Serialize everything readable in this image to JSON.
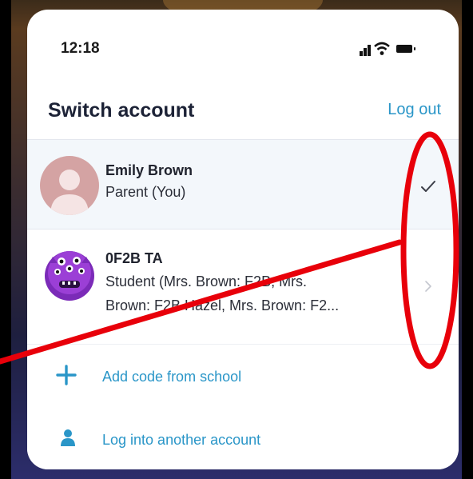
{
  "status": {
    "time": "12:18"
  },
  "header": {
    "title": "Switch account",
    "logout_label": "Log out"
  },
  "accounts": [
    {
      "name": "Emily Brown",
      "role": "Parent (You)",
      "selected": true,
      "indicator_icon": "checkmark-icon"
    },
    {
      "name": "0F2B TA",
      "role_line1": "Student (Mrs. Brown: F2B, Mrs.",
      "role_line2": "Brown: F2B Hazel, Mrs. Brown: F2...",
      "selected": false,
      "indicator_icon": "chevron-right-icon"
    }
  ],
  "actions": [
    {
      "label": "Add code from school",
      "icon": "plus-icon"
    },
    {
      "label": "Log into another account",
      "icon": "person-icon"
    }
  ],
  "colors": {
    "accent": "#2a96c8",
    "annotation": "#e8000a",
    "title": "#1c2236"
  }
}
